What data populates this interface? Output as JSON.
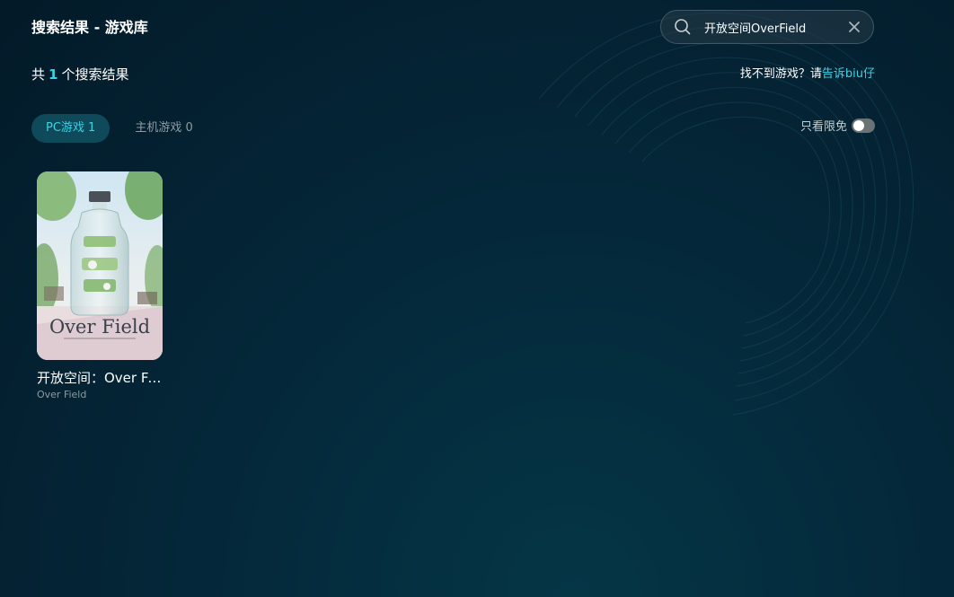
{
  "header": {
    "title": "搜索结果 - 游戏库"
  },
  "search": {
    "value": "开放空间OverField",
    "placeholder": ""
  },
  "results": {
    "prefix": "共",
    "count": "1",
    "suffix": "个搜索结果"
  },
  "feedback": {
    "text": "找不到游戏？请",
    "link": "告诉biu仔"
  },
  "tabs": [
    {
      "label": "PC游戏 1",
      "active": true
    },
    {
      "label": "主机游戏 0",
      "active": false
    }
  ],
  "filter": {
    "label": "只看限免",
    "enabled": false
  },
  "games": [
    {
      "title": "开放空间：Over Field",
      "subtitle": "Over Field",
      "cover_logo_text": "Over Field"
    }
  ],
  "colors": {
    "accent": "#3ad3e6",
    "background": "#032030",
    "tab_active_bg": "#0e4a5a",
    "muted_text": "#8d9ca4"
  },
  "icons": {
    "search": "search-icon",
    "clear": "close-icon",
    "toggle": "toggle-switch"
  }
}
